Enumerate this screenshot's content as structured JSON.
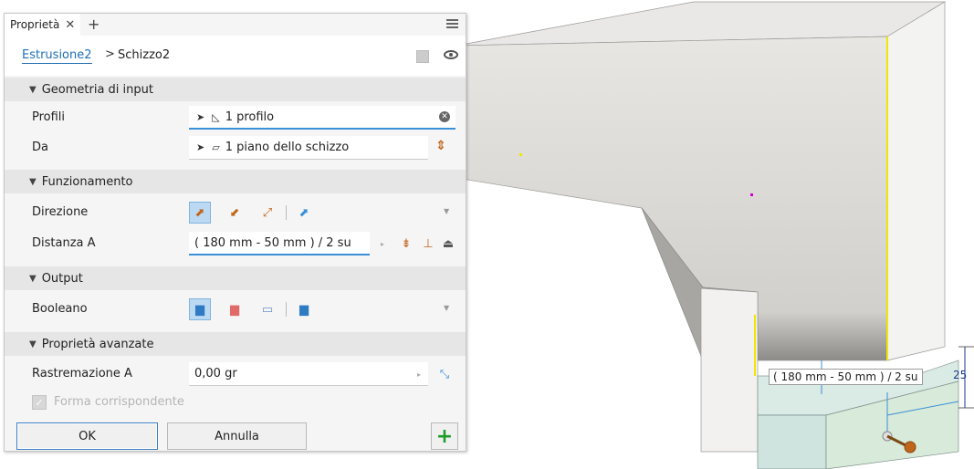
{
  "panel": {
    "tab_label": "Proprietà",
    "tab_close": "✕",
    "add_tab": "+",
    "breadcrumb": {
      "feature": "Estrusione2",
      "separator": ">",
      "sketch": "Schizzo2"
    },
    "sections": {
      "input": {
        "title": "Geometria di input",
        "profiles_label": "Profili",
        "profiles_value": "1 profilo",
        "from_label": "Da",
        "from_value": "1 piano dello schizzo"
      },
      "behavior": {
        "title": "Funzionamento",
        "direction_label": "Direzione",
        "distance_label": "Distanza A",
        "distance_value": "( 180 mm - 50 mm ) / 2 su"
      },
      "output": {
        "title": "Output",
        "boolean_label": "Booleano"
      },
      "advanced": {
        "title": "Proprietà avanzate",
        "taper_label": "Rastremazione A",
        "taper_value": "0,00 gr",
        "match_shape_label": "Forma corrispondente"
      }
    },
    "buttons": {
      "ok": "OK",
      "cancel": "Annulla",
      "apply": "+"
    }
  },
  "viewport": {
    "dimension_label": "( 180 mm - 50 mm ) / 2 su",
    "dimension_25": "25"
  },
  "colors": {
    "accent": "#3a8fd9",
    "selected_bg": "#bcd9f3",
    "part_face": "#e4e2df",
    "preview": "#cfe3e0",
    "edge_highlight": "#f0e600"
  }
}
